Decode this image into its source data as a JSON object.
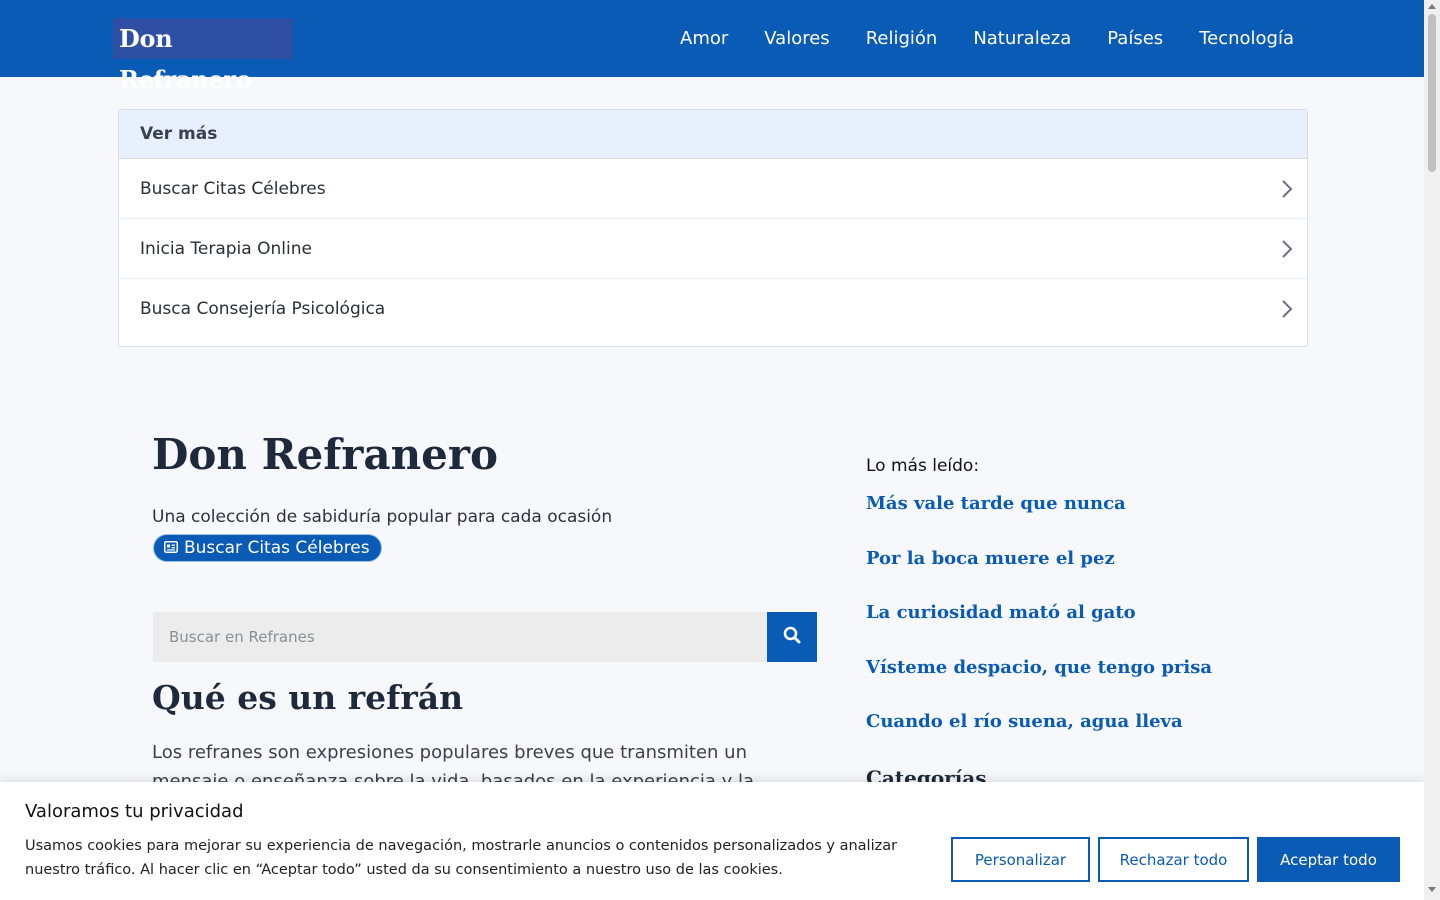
{
  "header": {
    "logo": "Don Refranero",
    "nav": [
      "Amor",
      "Valores",
      "Religión",
      "Naturaleza",
      "Países",
      "Tecnología"
    ]
  },
  "see_more": {
    "title": "Ver más",
    "items": [
      "Buscar Citas Célebres",
      "Inicia Terapia Online",
      "Busca Consejería Psicológica"
    ]
  },
  "main": {
    "site_title": "Don Refranero",
    "tagline": "Una colección de sabiduría popular para cada ocasión",
    "pill_button": "Buscar Citas Célebres",
    "search_placeholder": "Buscar en Refranes",
    "section_title": "Qué es un refrán",
    "paragraph": "Los refranes son expresiones populares breves que transmiten un mensaje o enseñanza sobre la vida, basados en la experiencia y la sabiduría de"
  },
  "sidebar": {
    "most_read_title": "Lo más leído:",
    "most_read": [
      "Más vale tarde que nunca",
      "Por la boca muere el pez",
      "La curiosidad mató al gato",
      "Vísteme despacio, que tengo prisa",
      "Cuando el río suena, agua lleva"
    ],
    "categories_title": "Categorías"
  },
  "cookie": {
    "title": "Valoramos tu privacidad",
    "text": "Usamos cookies para mejorar su experiencia de navegación, mostrarle anuncios o contenidos personalizados y analizar nuestro tráfico. Al hacer clic en “Aceptar todo” usted da su consentimiento a nuestro uso de las cookies.",
    "customize": "Personalizar",
    "reject": "Rechazar todo",
    "accept": "Aceptar todo"
  },
  "colors": {
    "brand": "#0a5bb5",
    "logo_bg": "#2e4fa3",
    "card_head_bg": "#e8f0fe"
  },
  "icons": [
    "chevron-right-icon",
    "id-card-icon",
    "search-icon"
  ]
}
